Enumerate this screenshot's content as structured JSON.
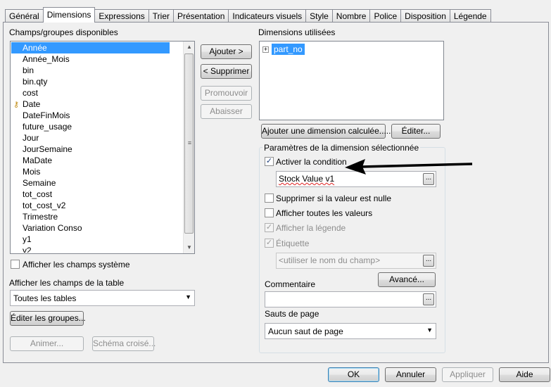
{
  "tabs": [
    "Général",
    "Dimensions",
    "Expressions",
    "Trier",
    "Présentation",
    "Indicateurs visuels",
    "Style",
    "Nombre",
    "Police",
    "Disposition",
    "Légende"
  ],
  "active_tab": "Dimensions",
  "left": {
    "available_label": "Champs/groupes disponibles",
    "fields": [
      "Année",
      "Année_Mois",
      "bin",
      "bin.qty",
      "cost",
      "Date",
      "DateFinMois",
      "future_usage",
      "Jour",
      "JourSemaine",
      "MaDate",
      "Mois",
      "Semaine",
      "tot_cost",
      "tot_cost_v2",
      "Trimestre",
      "Variation Conso",
      "y1",
      "y2"
    ],
    "selected_field": "Année",
    "key_field": "Date",
    "show_system_fields_label": "Afficher les champs système",
    "show_table_fields_label": "Afficher les champs de la table",
    "table_select_value": "Toutes les tables",
    "edit_groups_label": "Éditer les groupes...",
    "animate_label": "Animer...",
    "cross_schema_label": "Schéma croisé..."
  },
  "middle": {
    "add_label": "Ajouter >",
    "remove_label": "< Supprimer",
    "promote_label": "Promouvoir",
    "demote_label": "Abaisser"
  },
  "right": {
    "used_label": "Dimensions utilisées",
    "used_dimensions": [
      "part_no"
    ],
    "add_calculated_label": "Ajouter une dimension calculée......",
    "edit_label": "Éditer...",
    "settings_group_title": "Paramètres de la dimension sélectionnée",
    "enable_condition_label": "Activer la condition",
    "enable_condition_checked": true,
    "condition_value": "Stock Value v1",
    "suppress_null_label": "Supprimer si la valeur est nulle",
    "show_all_values_label": "Afficher toutes les valeurs",
    "show_legend_label": "Afficher la légende",
    "label_label": "Étiquette",
    "label_placeholder": "<utiliser le nom du champ>",
    "advanced_label": "Avancé...",
    "comment_label": "Commentaire",
    "page_breaks_label": "Sauts de page",
    "page_breaks_value": "Aucun saut de page",
    "ellipsis": "..."
  },
  "footer": {
    "ok_label": "OK",
    "cancel_label": "Annuler",
    "apply_label": "Appliquer",
    "help_label": "Aide"
  }
}
